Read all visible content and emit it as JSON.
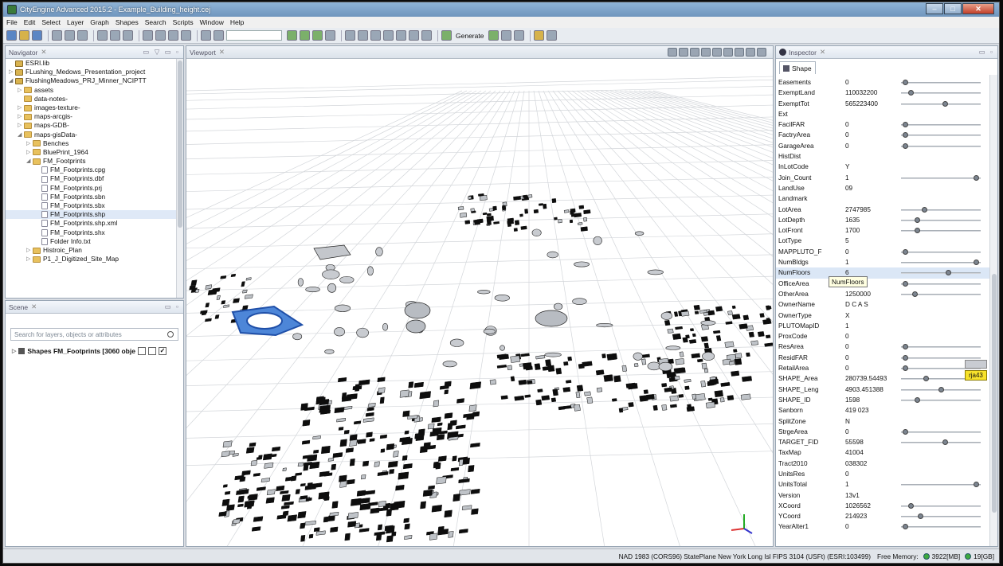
{
  "window": {
    "title": "CityEngine Advanced 2015.2 - Example_Building_height.cej"
  },
  "menu": [
    "File",
    "Edit",
    "Select",
    "Layer",
    "Graph",
    "Shapes",
    "Search",
    "Scripts",
    "Window",
    "Help"
  ],
  "toolbar": {
    "generate_label": "Generate"
  },
  "navigator": {
    "title": "Navigator",
    "items": [
      {
        "label": "ESRI.lib",
        "indent": 0,
        "icon": "proj",
        "arrow": ""
      },
      {
        "label": "FLushing_Medows_Presentation_project",
        "indent": 0,
        "icon": "proj",
        "arrow": "▷"
      },
      {
        "label": "FlushingMeadows_PRJ_Minner_NCIPTT",
        "indent": 0,
        "icon": "proj",
        "arrow": "◢"
      },
      {
        "label": "assets",
        "indent": 1,
        "icon": "folder",
        "arrow": "▷"
      },
      {
        "label": "data-notes-",
        "indent": 1,
        "icon": "folder",
        "arrow": ""
      },
      {
        "label": "images-texture-",
        "indent": 1,
        "icon": "folder",
        "arrow": "▷"
      },
      {
        "label": "maps-arcgis-",
        "indent": 1,
        "icon": "folder",
        "arrow": "▷"
      },
      {
        "label": "maps-GDB-",
        "indent": 1,
        "icon": "folder",
        "arrow": "▷"
      },
      {
        "label": "maps-gisData-",
        "indent": 1,
        "icon": "folder",
        "arrow": "◢"
      },
      {
        "label": "Benches",
        "indent": 2,
        "icon": "folder",
        "arrow": "▷"
      },
      {
        "label": "BluePrint_1964",
        "indent": 2,
        "icon": "folder",
        "arrow": "▷"
      },
      {
        "label": "FM_Footprints",
        "indent": 2,
        "icon": "folder",
        "arrow": "◢"
      },
      {
        "label": "FM_Footprints.cpg",
        "indent": 3,
        "icon": "file",
        "arrow": ""
      },
      {
        "label": "FM_Footprints.dbf",
        "indent": 3,
        "icon": "file",
        "arrow": ""
      },
      {
        "label": "FM_Footprints.prj",
        "indent": 3,
        "icon": "file",
        "arrow": ""
      },
      {
        "label": "FM_Footprints.sbn",
        "indent": 3,
        "icon": "file",
        "arrow": ""
      },
      {
        "label": "FM_Footprints.sbx",
        "indent": 3,
        "icon": "file",
        "arrow": ""
      },
      {
        "label": "FM_Footprints.shp",
        "indent": 3,
        "icon": "file",
        "arrow": "",
        "selected": true
      },
      {
        "label": "FM_Footprints.shp.xml",
        "indent": 3,
        "icon": "file",
        "arrow": ""
      },
      {
        "label": "FM_Footprints.shx",
        "indent": 3,
        "icon": "file",
        "arrow": ""
      },
      {
        "label": "Folder Info.txt",
        "indent": 3,
        "icon": "file",
        "arrow": ""
      },
      {
        "label": "Histroic_Plan",
        "indent": 2,
        "icon": "folder",
        "arrow": "▷"
      },
      {
        "label": "P1_J_Digitized_Site_Map",
        "indent": 2,
        "icon": "folder",
        "arrow": "▷"
      }
    ]
  },
  "scene": {
    "title": "Scene",
    "search_placeholder": "Search for layers, objects or attributes",
    "layer_label": "Shapes FM_Footprints [3060 obje"
  },
  "viewport": {
    "title": "Viewport"
  },
  "inspector": {
    "title": "Inspector",
    "tab": "Shape",
    "tooltip": "NumFloors",
    "collab_tag": "rja43",
    "attributes": [
      {
        "name": "Easements",
        "value": "0",
        "slider": 0.02
      },
      {
        "name": "ExemptLand",
        "value": "110032200",
        "slider": 0.1
      },
      {
        "name": "ExemptTot",
        "value": "565223400",
        "slider": 0.55
      },
      {
        "name": "Ext",
        "value": ""
      },
      {
        "name": "FacilFAR",
        "value": "0",
        "slider": 0.02
      },
      {
        "name": "FactryArea",
        "value": "0",
        "slider": 0.02
      },
      {
        "name": "GarageArea",
        "value": "0",
        "slider": 0.02
      },
      {
        "name": "HistDist",
        "value": ""
      },
      {
        "name": "InLotCode",
        "value": "Y"
      },
      {
        "name": "Join_Count",
        "value": "1",
        "slider": 0.97
      },
      {
        "name": "LandUse",
        "value": "09"
      },
      {
        "name": "Landmark",
        "value": ""
      },
      {
        "name": "LotArea",
        "value": "2747985",
        "slider": 0.28
      },
      {
        "name": "LotDepth",
        "value": "1635",
        "slider": 0.18
      },
      {
        "name": "LotFront",
        "value": "1700",
        "slider": 0.18
      },
      {
        "name": "LotType",
        "value": "5"
      },
      {
        "name": "MAPPLUTO_F",
        "value": "0",
        "slider": 0.02
      },
      {
        "name": "NumBldgs",
        "value": "1",
        "slider": 0.97
      },
      {
        "name": "NumFloors",
        "value": "6",
        "slider": 0.6,
        "highlight": true
      },
      {
        "name": "OfficeArea",
        "value": "0",
        "slider": 0.02
      },
      {
        "name": "OtherArea",
        "value": "1250000",
        "slider": 0.15
      },
      {
        "name": "OwnerName",
        "value": "D C A S"
      },
      {
        "name": "OwnerType",
        "value": "X"
      },
      {
        "name": "PLUTOMapID",
        "value": "1"
      },
      {
        "name": "ProxCode",
        "value": "0"
      },
      {
        "name": "ResArea",
        "value": "0",
        "slider": 0.02
      },
      {
        "name": "ResidFAR",
        "value": "0",
        "slider": 0.02
      },
      {
        "name": "RetailArea",
        "value": "0",
        "slider": 0.02
      },
      {
        "name": "SHAPE_Area",
        "value": "280739.54493",
        "slider": 0.3
      },
      {
        "name": "SHAPE_Leng",
        "value": "4903.451388",
        "slider": 0.5
      },
      {
        "name": "SHAPE_ID",
        "value": "1598",
        "slider": 0.18
      },
      {
        "name": "Sanborn",
        "value": "419 023"
      },
      {
        "name": "SplitZone",
        "value": "N"
      },
      {
        "name": "StrgeArea",
        "value": "0",
        "slider": 0.02
      },
      {
        "name": "TARGET_FID",
        "value": "55598",
        "slider": 0.55
      },
      {
        "name": "TaxMap",
        "value": "41004"
      },
      {
        "name": "Tract2010",
        "value": "038302"
      },
      {
        "name": "UnitsRes",
        "value": "0"
      },
      {
        "name": "UnitsTotal",
        "value": "1",
        "slider": 0.97
      },
      {
        "name": "Version",
        "value": "13v1"
      },
      {
        "name": "XCoord",
        "value": "1026562",
        "slider": 0.1
      },
      {
        "name": "YCoord",
        "value": "214923",
        "slider": 0.22
      },
      {
        "name": "YearAlter1",
        "value": "0",
        "slider": 0.02
      }
    ]
  },
  "status": {
    "projection": "NAD 1983 (CORS96) StatePlane New York Long Isl FIPS 3104 (USFt) (ESRI:103499)",
    "free_memory_label": "Free Memory:",
    "memory1": "3922[MB]",
    "memory2": "19[GB]"
  }
}
